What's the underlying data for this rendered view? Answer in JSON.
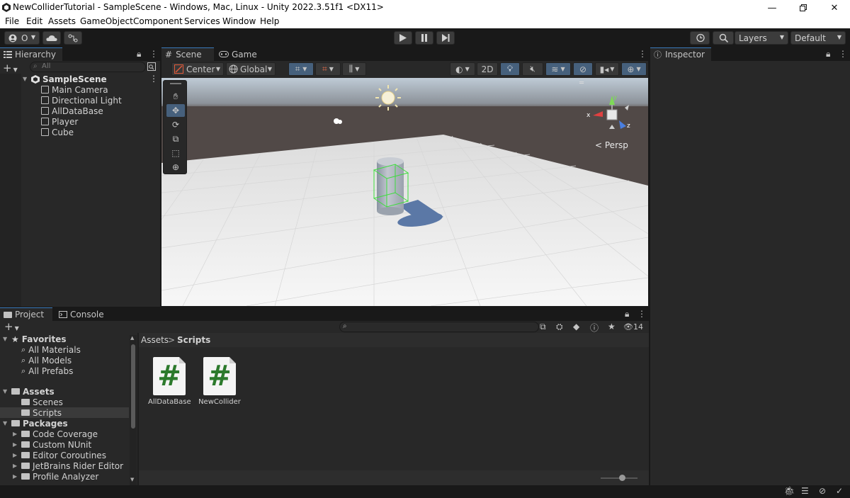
{
  "window": {
    "title": "NewColliderTutorial - SampleScene - Windows, Mac, Linux - Unity 2022.3.51f1 <DX11>"
  },
  "menu": [
    "File",
    "Edit",
    "Assets",
    "GameObject",
    "Component",
    "Services",
    "Window",
    "Help"
  ],
  "toolbar": {
    "account_label": "O",
    "layers_label": "Layers",
    "layout_label": "Default"
  },
  "hierarchy": {
    "tab": "Hierarchy",
    "search_placeholder": "All",
    "scene": "SampleScene",
    "items": [
      "Main Camera",
      "Directional Light",
      "AllDataBase",
      "Player",
      "Cube"
    ]
  },
  "scene_tabs": {
    "scene": "Scene",
    "game": "Game"
  },
  "scene_toolbar": {
    "pivot": "Center",
    "space": "Global",
    "mode_2d": "2D"
  },
  "gizmo": {
    "x": "x",
    "y": "y",
    "z": "z",
    "projection": "Persp"
  },
  "inspector": {
    "tab": "Inspector"
  },
  "project": {
    "tab_project": "Project",
    "tab_console": "Console",
    "hidden_count": "14",
    "breadcrumb_root": "Assets",
    "breadcrumb_current": "Scripts",
    "favorites": {
      "label": "Favorites",
      "items": [
        "All Materials",
        "All Models",
        "All Prefabs"
      ]
    },
    "assets": {
      "label": "Assets",
      "items": [
        "Scenes",
        "Scripts"
      ]
    },
    "packages": {
      "label": "Packages",
      "items": [
        "Code Coverage",
        "Custom NUnit",
        "Editor Coroutines",
        "JetBrains Rider Editor",
        "Profile Analyzer"
      ]
    },
    "files": [
      "AllDataBase",
      "NewCollider"
    ]
  },
  "colors": {
    "accent": "#3a79bb",
    "selection": "#2c5d87",
    "panel": "#282828",
    "csharp_hash": "#2c7a2c"
  }
}
